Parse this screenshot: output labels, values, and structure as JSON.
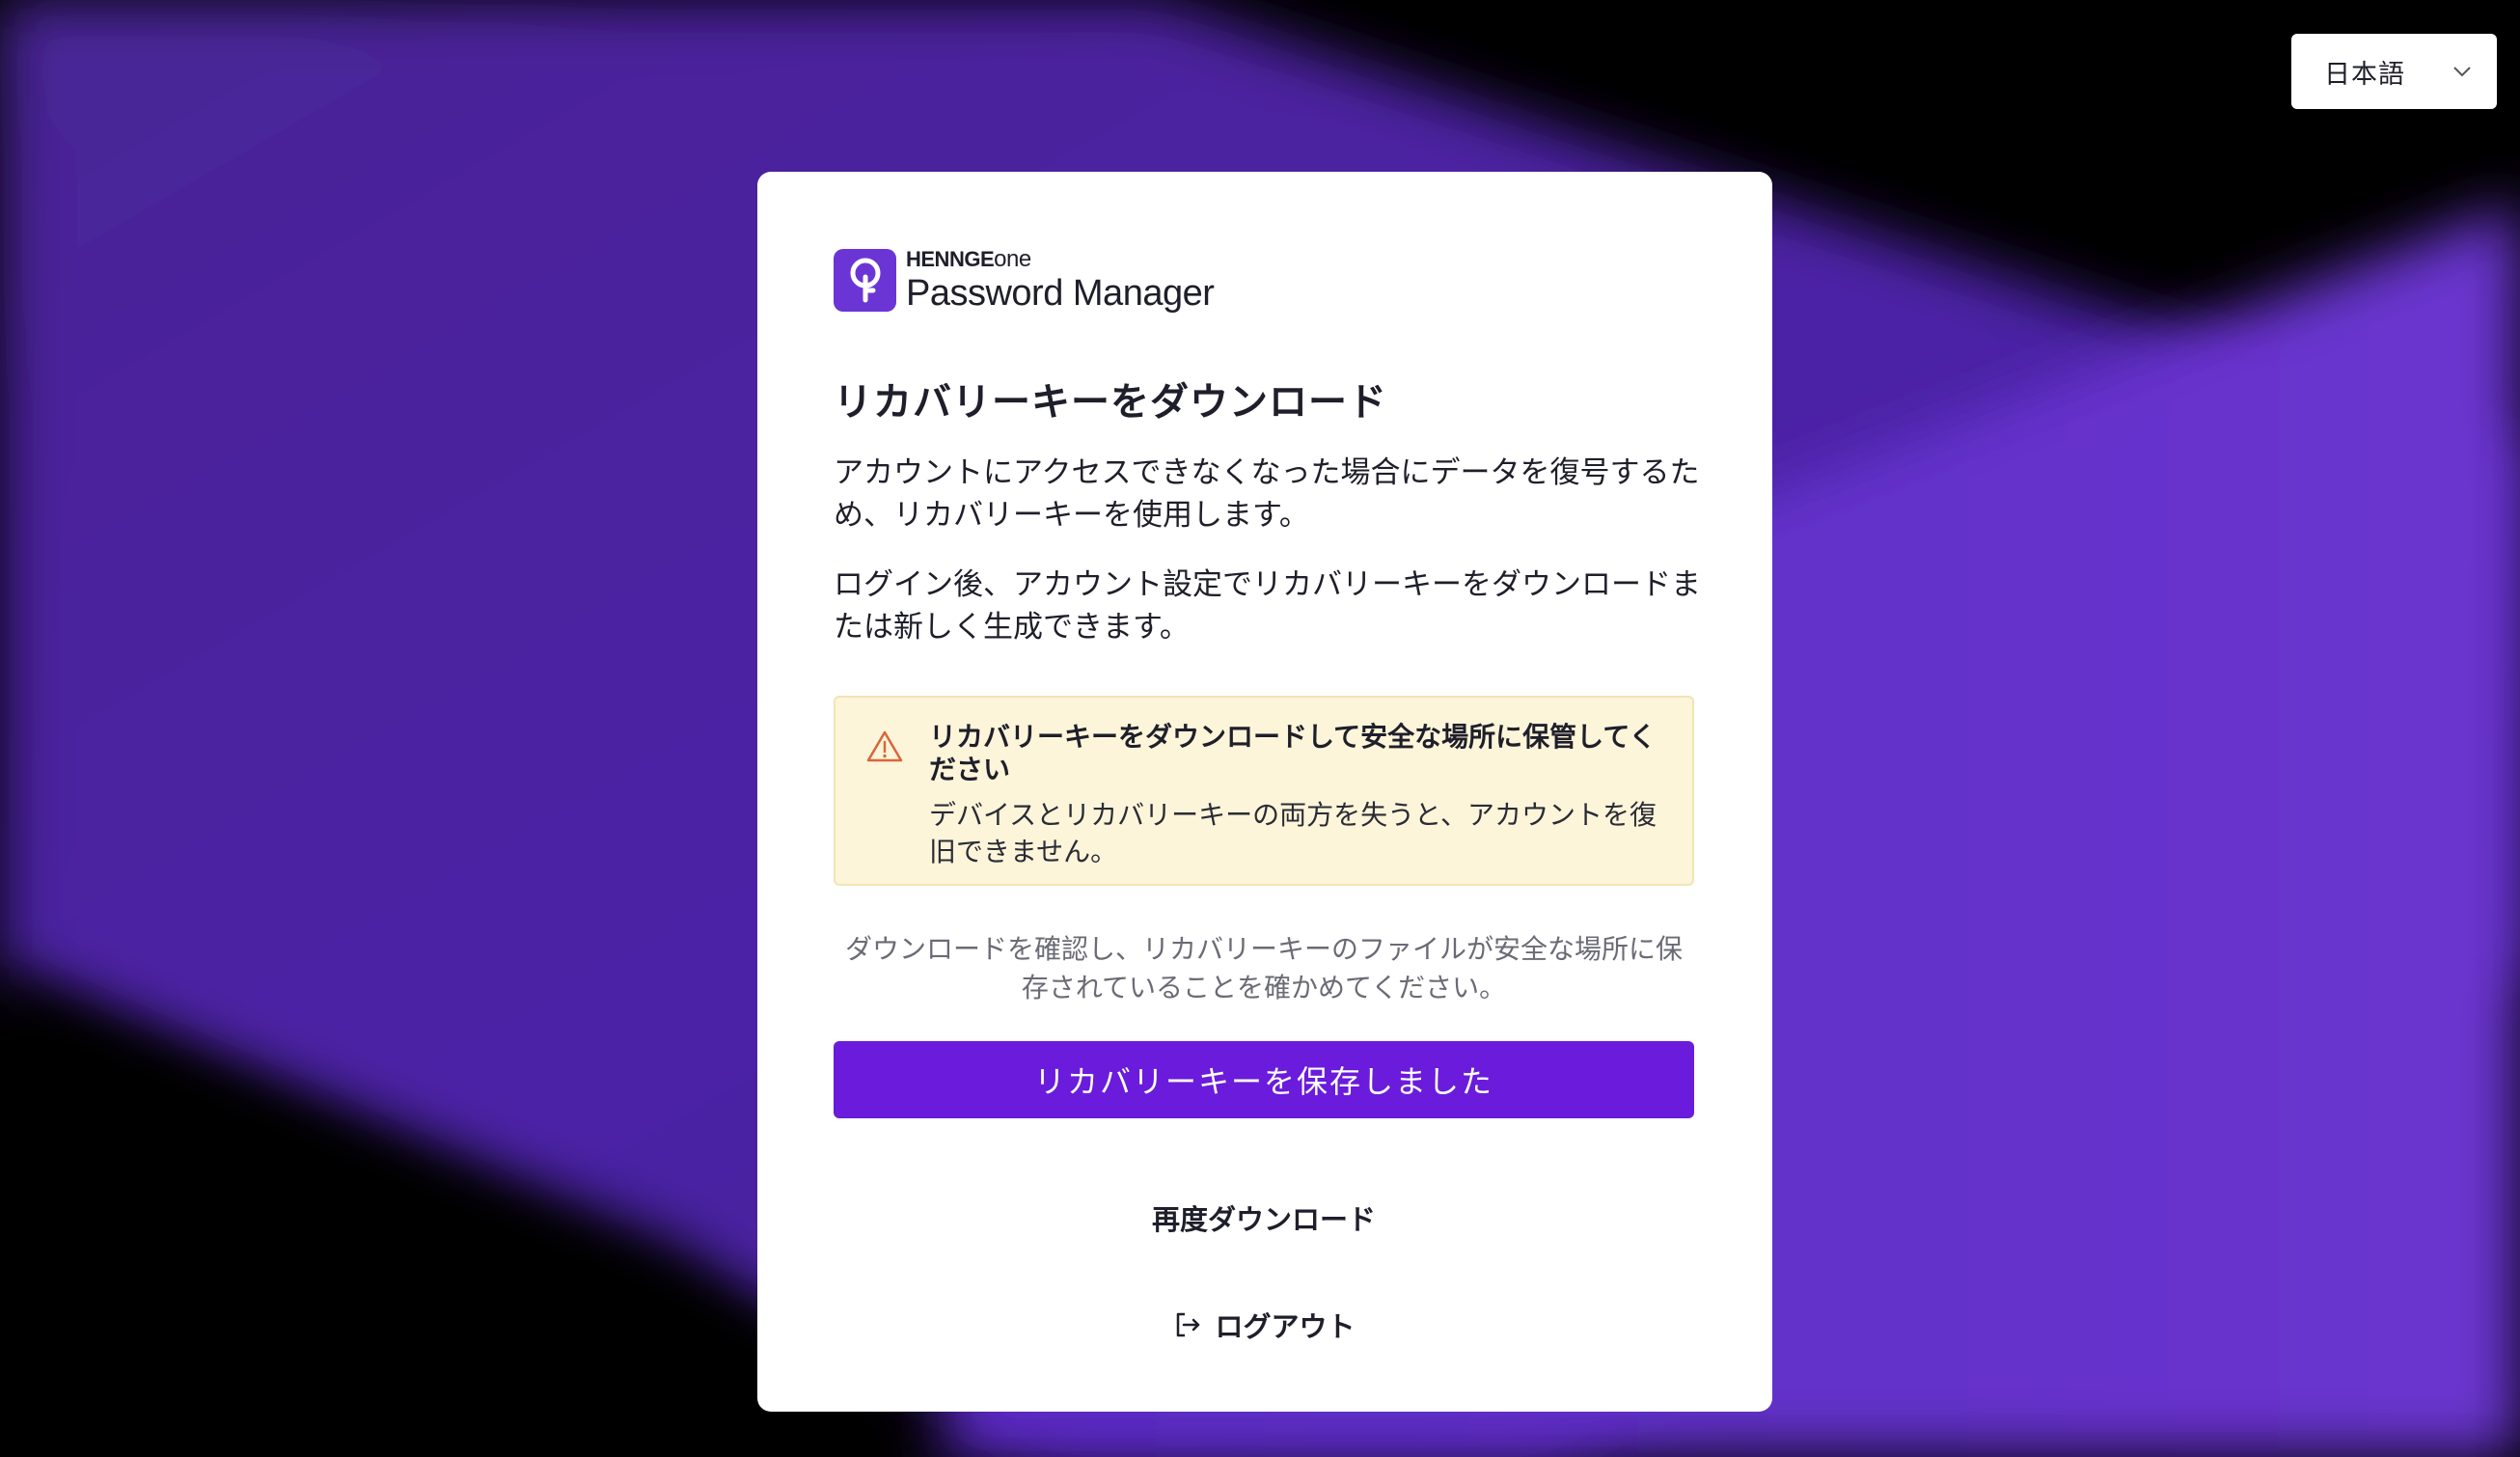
{
  "language_selector": {
    "value": "日本語",
    "icon": "chevron-down-icon"
  },
  "logo": {
    "brand_top_a": "HENNGE",
    "brand_top_b": "one",
    "product": "Password Manager",
    "icon": "key-icon"
  },
  "title": "リカバリーキーをダウンロード",
  "paragraphs": [
    "アカウントにアクセスできなくなった場合にデータを復号するため、リカバリーキーを使用します。",
    "ログイン後、アカウント設定でリカバリーキーをダウンロードまたは新しく生成できます。"
  ],
  "alert": {
    "icon": "warning-icon",
    "title": "リカバリーキーをダウンロードして安全な場所に保管してください",
    "body": "デバイスとリカバリーキーの両方を失うと、アカウントを復旧できません。"
  },
  "confirm_text": "ダウンロードを確認し、リカバリーキーのファイルが安全な場所に保存されていることを確かめてください。",
  "primary_button": "リカバリーキーを保存しました",
  "redownload_button": "再度ダウンロード",
  "logout": {
    "label": "ログアウト",
    "icon": "logout-icon"
  },
  "colors": {
    "background_accent": "#5a2bbf",
    "primary": "#6a1bdb",
    "alert_bg": "#fdf5d9",
    "warning": "#d9663b"
  }
}
